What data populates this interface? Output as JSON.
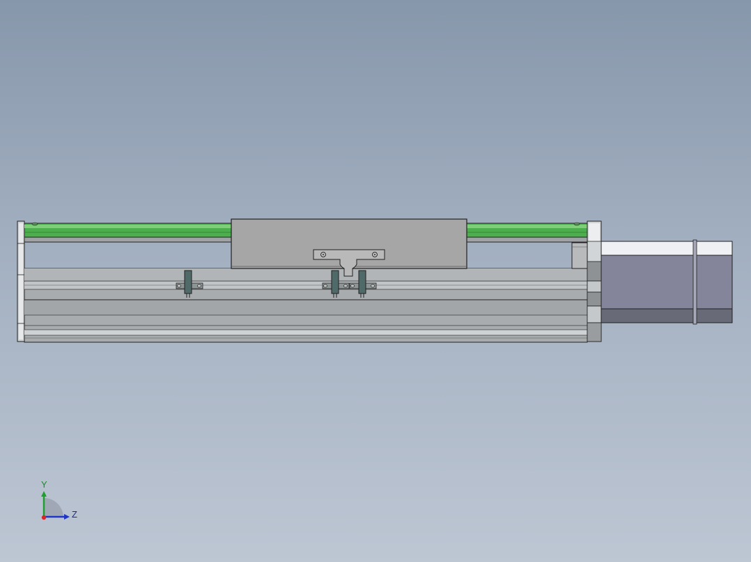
{
  "viewport": {
    "background_top": "#8797ab",
    "background_bottom": "#bdc6d3"
  },
  "model": {
    "guide_rail_color": "#4cae4c",
    "body_color": "#a9acaf",
    "carriage_color": "#a6a6a6",
    "motor_color": "#84859a",
    "sensor_color": "#4f6a68",
    "edge_color": "#202020"
  },
  "triad": {
    "y_label": "Y",
    "z_label": "Z",
    "y_color": "#1fa02e",
    "z_color": "#1f35c8",
    "x_color": "#d8262b"
  }
}
